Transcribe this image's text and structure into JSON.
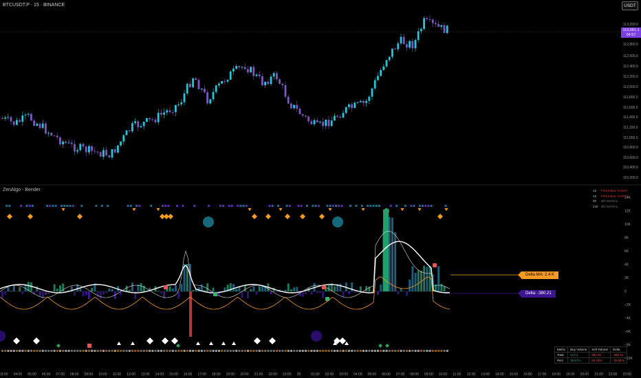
{
  "header": {
    "symbol_title": "BTCUSDT.P · 15 · BINANCE",
    "currency_button": "USDT"
  },
  "price_axis": {
    "labels": [
      "113,200.0",
      "112,800.0",
      "112,600.0",
      "112,400.0",
      "112,200.0",
      "112,000.0",
      "111,800.0",
      "111,600.0",
      "111,400.0",
      "111,200.0",
      "111,000.0",
      "110,800.0",
      "110,600.0",
      "110,400.0",
      "110,200.0"
    ],
    "current_price": "113,061.1",
    "countdown": "04:57"
  },
  "colors": {
    "bull": "#26c6da",
    "bear": "#7e57c2",
    "accent": "#7b3fe4",
    "orange": "#f59a23"
  },
  "indicator": {
    "title": "ZenAlgo - Bender",
    "axis_labels": [
      "14K",
      "12K",
      "10K",
      "8K",
      "6K",
      "4K",
      "2K",
      "0",
      "−2K",
      "−4K",
      "−6K",
      "−8K",
      "−10K"
    ],
    "legend": [
      {
        "tf": "15",
        "label": "POSSIBLE SHORT",
        "style": "red"
      },
      {
        "tf": "15",
        "label": "POSSIBLE SHORT",
        "style": "red"
      },
      {
        "tf": "60",
        "label": "NO SIGNAL",
        "style": "gray"
      },
      {
        "tf": "240",
        "label": "NO SIGNAL",
        "style": "gray"
      }
    ],
    "delta_ma_tag": "Delta MA: 2.4 K",
    "delta_tag": "Delta: -380.21"
  },
  "stats_table": {
    "headers": [
      "Metric",
      "Buy Volume",
      "Sell Volume",
      "Delta"
    ],
    "rows": [
      [
        "Total",
        "517.4",
        "897.61",
        "-380.21"
      ],
      [
        "Perc",
        "36.57%",
        "63.43%",
        "-26.87%"
      ]
    ]
  },
  "time_axis": [
    "03:00",
    "04:00",
    "05:00",
    "06:00",
    "07:00",
    "08:00",
    "09:00",
    "10:00",
    "11:00",
    "12:00",
    "13:00",
    "14:00",
    "15:00",
    "16:00",
    "17:00",
    "18:00",
    "19:00",
    "20:00",
    "21:00",
    "22:00",
    "23:00",
    "28",
    "01:00",
    "02:00",
    "03:00",
    "04:00",
    "05:00",
    "06:00",
    "07:00",
    "08:00",
    "09:00",
    "10:00",
    "11:00",
    "12:00",
    "13:00",
    "14:00",
    "15:00",
    "16:00",
    "17:00",
    "18:00",
    "19:00",
    "20:00",
    "21:00",
    "22:00",
    "23:00"
  ]
}
